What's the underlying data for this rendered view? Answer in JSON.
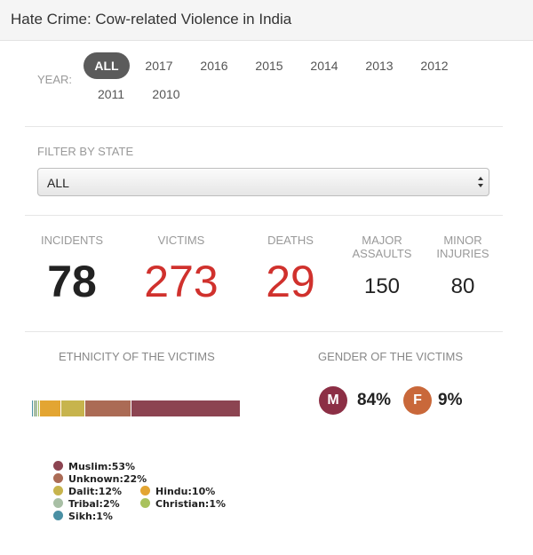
{
  "header": {
    "title": "Hate Crime: Cow-related Violence in India"
  },
  "year_filter": {
    "label": "YEAR:",
    "options": [
      "ALL",
      "2017",
      "2016",
      "2015",
      "2014",
      "2013",
      "2012",
      "2011",
      "2010"
    ],
    "selected": "ALL"
  },
  "state_filter": {
    "label": "FILTER BY STATE",
    "selected": "ALL"
  },
  "stats": {
    "incidents": {
      "label": "INCIDENTS",
      "value": "78"
    },
    "victims": {
      "label": "VICTIMS",
      "value": "273"
    },
    "deaths": {
      "label": "DEATHS",
      "value": "29"
    },
    "major_assaults": {
      "label_line1": "MAJOR",
      "label_line2": "ASSAULTS",
      "value": "150"
    },
    "minor_injuries": {
      "label_line1": "MINOR",
      "label_line2": "INJURIES",
      "value": "80"
    }
  },
  "ethnicity": {
    "title": "ETHNICITY OF THE VICTIMS",
    "chart_data": {
      "type": "bar",
      "categories": [
        "Sikh",
        "Tribal",
        "Christian",
        "Hindu",
        "Dalit",
        "Unknown",
        "Muslim"
      ],
      "values": [
        1,
        2,
        1,
        10,
        12,
        22,
        53
      ],
      "unit": "%",
      "colors": [
        "#4a90a4",
        "#a8bfa5",
        "#a9c25d",
        "#e3a532",
        "#c7b44d",
        "#ab6b55",
        "#8c4451"
      ]
    },
    "legend": [
      {
        "text": "Muslim:53%",
        "color": "#8c4451"
      },
      {
        "text": "Unknown:22%",
        "color": "#ab6b55"
      },
      {
        "text": "Dalit:12%",
        "color": "#c7b44d"
      },
      {
        "text": "Hindu:10%",
        "color": "#e3a532"
      },
      {
        "text": "Tribal:2%",
        "color": "#a8bfa5"
      },
      {
        "text": "Christian:1%",
        "color": "#a9c25d"
      },
      {
        "text": "Sikh:1%",
        "color": "#4a90a4"
      }
    ]
  },
  "gender": {
    "title": "GENDER OF THE VICTIMS",
    "male": {
      "letter": "M",
      "pct": "84%",
      "color": "#8c2f45"
    },
    "female": {
      "letter": "F",
      "pct": "9%",
      "color": "#c9683a"
    }
  }
}
